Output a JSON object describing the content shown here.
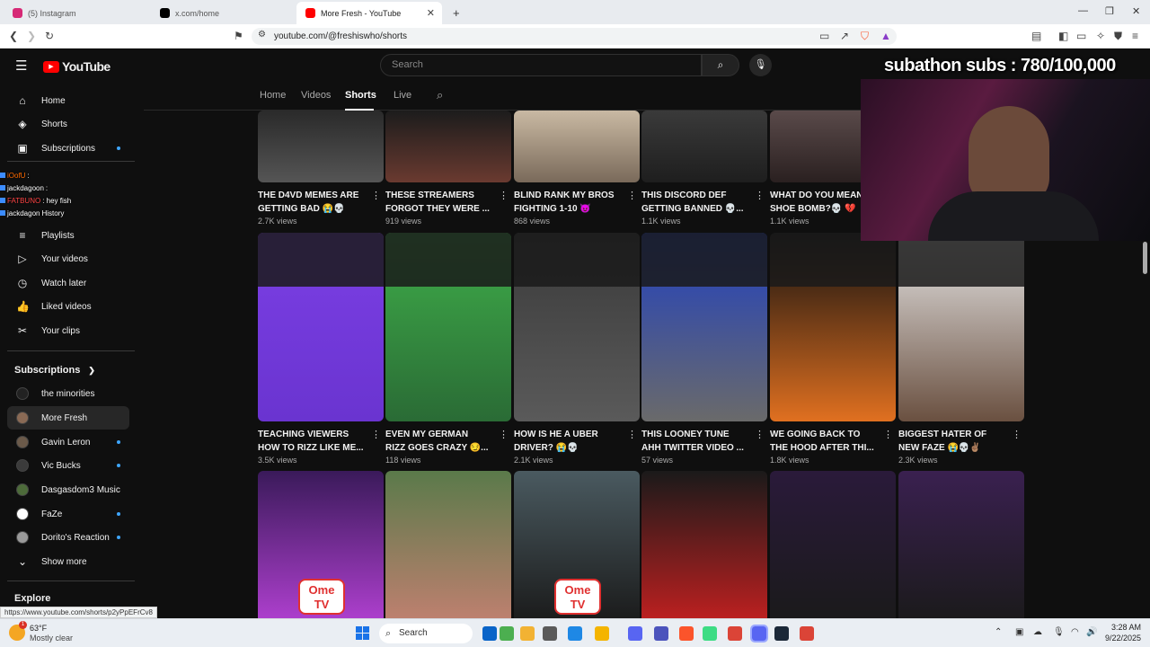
{
  "browser": {
    "tabs": [
      {
        "label": "(5) Instagram",
        "favicon_color": "#d62976"
      },
      {
        "label": "x.com/home",
        "favicon_color": "#000000"
      },
      {
        "label": "More Fresh - YouTube",
        "favicon_color": "#ff0000"
      }
    ],
    "new_tab": "+",
    "url": "youtube.com/@freshiswho/shorts"
  },
  "youtube": {
    "logo_text": "YouTube",
    "search_placeholder": "Search",
    "sidebar": {
      "main": [
        {
          "label": "Home",
          "icon": "home-icon",
          "glyph": "⌂"
        },
        {
          "label": "Shorts",
          "icon": "shorts-icon",
          "glyph": "◈"
        },
        {
          "label": "Subscriptions",
          "icon": "subscriptions-icon",
          "glyph": "▣"
        }
      ],
      "you": [
        {
          "label": "Playlists",
          "icon": "playlist-icon",
          "glyph": "≡"
        },
        {
          "label": "Your videos",
          "icon": "video-icon",
          "glyph": "▷"
        },
        {
          "label": "Watch later",
          "icon": "clock-icon",
          "glyph": "◷"
        },
        {
          "label": "Liked videos",
          "icon": "thumbs-up-icon",
          "glyph": "👍"
        },
        {
          "label": "Your clips",
          "icon": "scissors-icon",
          "glyph": "✂"
        }
      ],
      "subscriptions_heading": "Subscriptions",
      "channels": [
        {
          "label": "the minorities",
          "color": "#222222"
        },
        {
          "label": "More Fresh",
          "color": "#8a6a55"
        },
        {
          "label": "Gavin Leron",
          "color": "#6b5a4a"
        },
        {
          "label": "Vic Bucks",
          "color": "#3b3b3b"
        },
        {
          "label": "Dasgasdom3 Music",
          "color": "#4d6b3a"
        },
        {
          "label": "FaZe",
          "color": "#ffffff"
        },
        {
          "label": "Dorito's Reaction",
          "color": "#9a9a9a"
        }
      ],
      "show_more": "Show more",
      "explore_heading": "Explore"
    },
    "channel_tabs": [
      "Home",
      "Videos",
      "Shorts",
      "Live"
    ],
    "shorts": [
      {
        "title": "THE D4VD MEMES ARE\nGETTING BAD 😭💀",
        "views": "2.7K views",
        "c1": "#2a2a2a",
        "c2": "#555555"
      },
      {
        "title": "THESE STREAMERS\nFORGOT THEY WERE ...",
        "views": "919 views",
        "c1": "#1c1c1c",
        "c2": "#6a3a30"
      },
      {
        "title": "BLIND RANK MY BROS\nFIGHTING 1-10 😈",
        "views": "868 views",
        "c1": "#c9b9a3",
        "c2": "#7a6a5a"
      },
      {
        "title": "THIS DISCORD DEF\nGETTING BANNED 💀...",
        "views": "1.1K views",
        "c1": "#3a3a3a",
        "c2": "#1e1e1e"
      },
      {
        "title": "WHAT DO YOU MEAN\nSHOE BOMB?💀 💔",
        "views": "1.1K views",
        "c1": "#5a4a4a",
        "c2": "#2a2020"
      },
      {
        "title": "TEACHING VIEWERS\nHOW TO RIZZ LIKE ME...",
        "views": "3.5K views",
        "c1": "#7b3fe4",
        "c2": "#6a34d0"
      },
      {
        "title": "EVEN MY GERMAN\nRIZZ GOES CRAZY 😏...",
        "views": "118 views",
        "c1": "#3fae4a",
        "c2": "#2a6b35"
      },
      {
        "title": "HOW IS HE A UBER\nDRIVER? 😭💀",
        "views": "2.1K views",
        "c1": "#3a3a3a",
        "c2": "#5a5a5a"
      },
      {
        "title": "THIS LOONEY TUNE\nAHH TWITTER VIDEO ...",
        "views": "57 views",
        "c1": "#2040c0",
        "c2": "#6a6a6a"
      },
      {
        "title": "WE GOING BACK TO\nTHE HOOD AFTER THI...",
        "views": "1.8K views",
        "c1": "#101010",
        "c2": "#e07020"
      },
      {
        "title": "BIGGEST HATER OF\nNEW FAZE 😭💀✌🏽",
        "views": "2.3K views",
        "c1": "#e8e8e8",
        "c2": "#6a5040"
      },
      {
        "title": "",
        "views": "",
        "c1": "#3a1a5a",
        "c2": "#b040d0"
      },
      {
        "title": "",
        "views": "",
        "c1": "#5a7a4a",
        "c2": "#c08070"
      },
      {
        "title": "",
        "views": "",
        "c1": "#4a5a60",
        "c2": "#1a1a1a"
      },
      {
        "title": "",
        "views": "",
        "c1": "#1a1a1a",
        "c2": "#c02020"
      },
      {
        "title": "",
        "views": "",
        "c1": "#2a1a3a",
        "c2": "#1a1a1a"
      },
      {
        "title": "",
        "views": "",
        "c1": "#3a2050",
        "c2": "#1a1a1a"
      }
    ],
    "ometv_label": "Ome\nTV"
  },
  "overlay": {
    "subathon": "subathon subs : 780/100,000",
    "chat": [
      {
        "user": "iOofU",
        "text": ":",
        "color": "#ff6a00"
      },
      {
        "user": "jackdagoon",
        "text": ":",
        "color": "#ffffff"
      },
      {
        "user": "FATBUNO",
        "text": ": hey fish",
        "color": "#ff4444"
      },
      {
        "user": "jackdagon",
        "text": "History",
        "color": "#ffffff"
      }
    ],
    "status_url": "https://www.youtube.com/shorts/p2yPpEFrCv8"
  },
  "taskbar": {
    "weather_temp": "63°F",
    "weather_desc": "Mostly clear",
    "search_label": "Search",
    "time": "3:28 AM",
    "date": "9/22/2025",
    "apps": [
      "#0a64c8",
      "#4caf50",
      "#f2b233",
      "#5a5a5a",
      "#1e88e5",
      "#f4b400",
      "#5865f2",
      "#4b53bc",
      "#fb542b",
      "#3ddc84",
      "#db4437",
      "#5865f2",
      "#1b2838",
      "#db4437"
    ]
  },
  "colors": {
    "accent": "#ff0000",
    "link_blue": "#3ea6ff"
  }
}
